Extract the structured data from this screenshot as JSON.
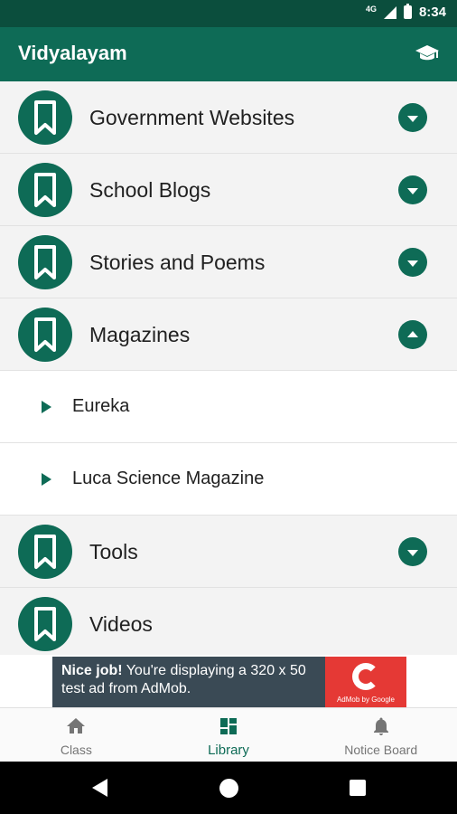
{
  "status_bar": {
    "network": "4G",
    "time": "8:34"
  },
  "app_bar": {
    "title": "Vidyalayam",
    "action_icon": "graduation-cap-icon"
  },
  "categories": [
    {
      "label": "Government Websites",
      "expanded": false
    },
    {
      "label": "School Blogs",
      "expanded": false
    },
    {
      "label": "Stories and Poems",
      "expanded": false
    },
    {
      "label": "Magazines",
      "expanded": true,
      "children": [
        "Eureka",
        "Luca Science Magazine"
      ]
    },
    {
      "label": "Tools",
      "expanded": false
    },
    {
      "label": "Videos",
      "expanded": false
    }
  ],
  "ad": {
    "headline": "Nice job!",
    "body": " You're displaying a 320 x 50 test ad from AdMob.",
    "logo_text": "AdMob by Google"
  },
  "bottom_nav": {
    "items": [
      {
        "label": "Class",
        "icon": "home-icon",
        "active": false
      },
      {
        "label": "Library",
        "icon": "dashboard-icon",
        "active": true
      },
      {
        "label": "Notice Board",
        "icon": "bell-icon",
        "active": false
      }
    ]
  },
  "colors": {
    "primary": "#0e6b56",
    "status_bar": "#0b4e3d",
    "ad_background": "#3a4a55",
    "ad_logo": "#e53935"
  }
}
